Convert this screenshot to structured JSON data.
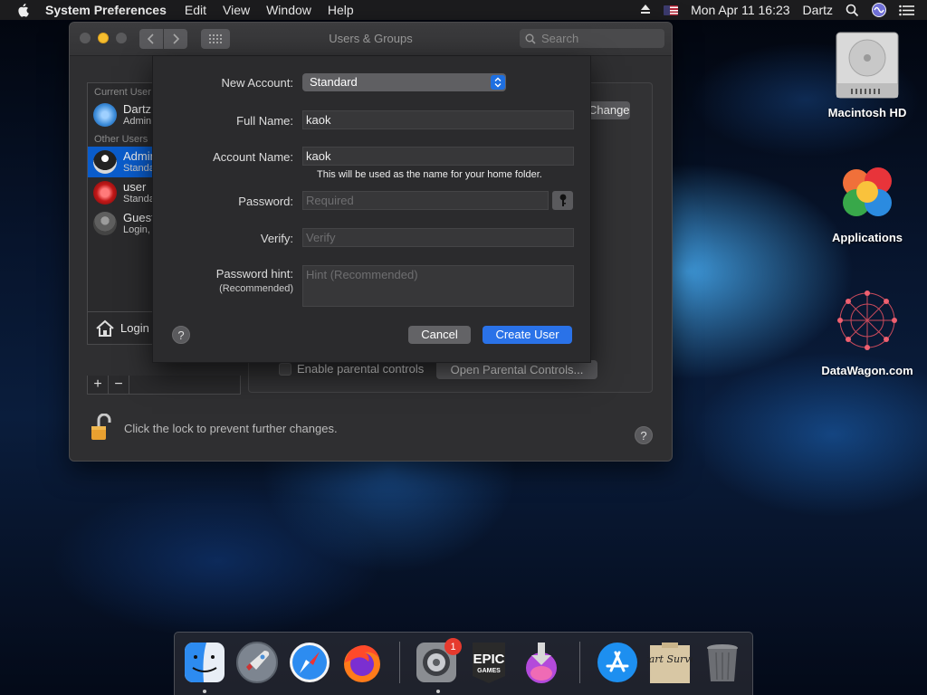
{
  "menubar": {
    "app_name": "System Preferences",
    "items": [
      "Edit",
      "View",
      "Window",
      "Help"
    ],
    "clock": "Mon Apr 11  16:23",
    "user": "Dartz"
  },
  "window": {
    "title": "Users & Groups",
    "search_placeholder": "Search",
    "list": {
      "current_header": "Current User",
      "other_header": "Other Users",
      "users": [
        {
          "name": "Dartz",
          "role": "Admin"
        },
        {
          "name": "Admin",
          "role": "Standard"
        },
        {
          "name": "user",
          "role": "Standard"
        },
        {
          "name": "Guest User",
          "role": "Login, sharing"
        }
      ],
      "login_options": "Login Options"
    },
    "change_password_button": "Change Password...",
    "parental_checkbox_label": "Enable parental controls",
    "parental_button": "Open Parental Controls...",
    "lock_text": "Click the lock to prevent further changes.",
    "help": "?"
  },
  "sheet": {
    "new_account_label": "New Account:",
    "new_account_value": "Standard",
    "full_name_label": "Full Name:",
    "full_name_value": "kaok",
    "account_name_label": "Account Name:",
    "account_name_value": "kaok",
    "account_name_hint": "This will be used as the name for your home folder.",
    "password_label": "Password:",
    "password_placeholder": "Required",
    "verify_label": "Verify:",
    "verify_placeholder": "Verify",
    "hint_label": "Password hint:",
    "hint_sublabel": "(Recommended)",
    "hint_placeholder": "Hint (Recommended)",
    "cancel_button": "Cancel",
    "create_button": "Create User",
    "help": "?"
  },
  "desktop": {
    "icons": [
      "Macintosh HD",
      "Applications",
      "DataWagon.com"
    ]
  },
  "dock": {
    "badge_count": "1",
    "epic_text": "EPIC",
    "epic_sub": "GAMES",
    "survey_text": "Start Survey"
  },
  "colors": {
    "accent": "#2a72e8",
    "selection": "#0a5ccb",
    "badge": "#e63a2e"
  }
}
